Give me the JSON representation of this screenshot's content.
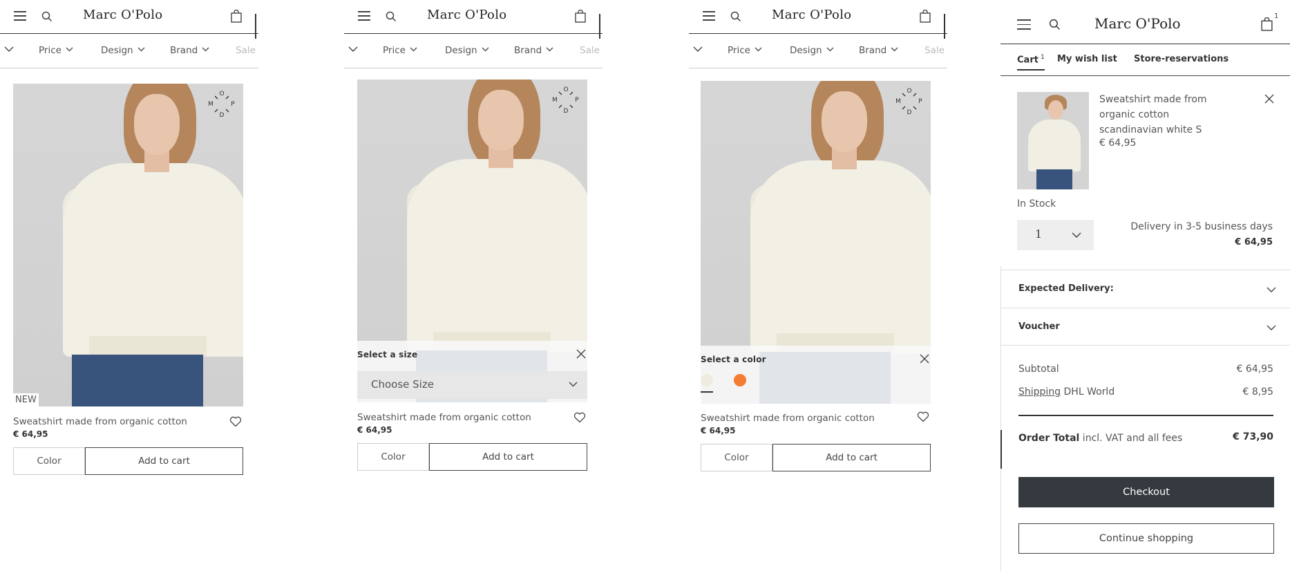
{
  "brand": "Marc O'Polo",
  "filters": {
    "items": [
      "Price",
      "Design",
      "Brand",
      "Sale"
    ]
  },
  "product": {
    "badge": "NEW",
    "name": "Sweatshirt made from organic cotton",
    "price": "€ 64,95",
    "color_button": "Color",
    "add_button": "Add to cart",
    "logo_letters": [
      "M",
      "O",
      "P",
      "D"
    ]
  },
  "size_overlay": {
    "title": "Select a size",
    "select_placeholder": "Choose Size"
  },
  "color_overlay": {
    "title": "Select a color",
    "swatches": [
      "#efecdf",
      "#f57c33"
    ]
  },
  "cart": {
    "bag_count": "1",
    "tabs": [
      {
        "label": "Cart",
        "count": "1"
      },
      {
        "label": "My wish list"
      },
      {
        "label": "Store-reservations"
      }
    ],
    "item": {
      "name": "Sweatshirt made from organic cotton scandinavian white   S",
      "price": "€ 64,95",
      "stock": "In Stock",
      "quantity": "1",
      "delivery": "Delivery in 3-5 business days",
      "line_price": "€ 64,95"
    },
    "accordions": [
      "Expected Delivery:",
      "Voucher"
    ],
    "summary": {
      "subtotal_label": "Subtotal",
      "subtotal_value": "€ 64,95",
      "shipping_link": "Shipping",
      "shipping_label": " DHL World",
      "shipping_value": "€ 8,95",
      "total_label": "Order Total",
      "total_note": " incl. VAT and all fees",
      "total_value": "€ 73,90"
    },
    "checkout_button": "Checkout",
    "continue_button": "Continue shopping"
  }
}
